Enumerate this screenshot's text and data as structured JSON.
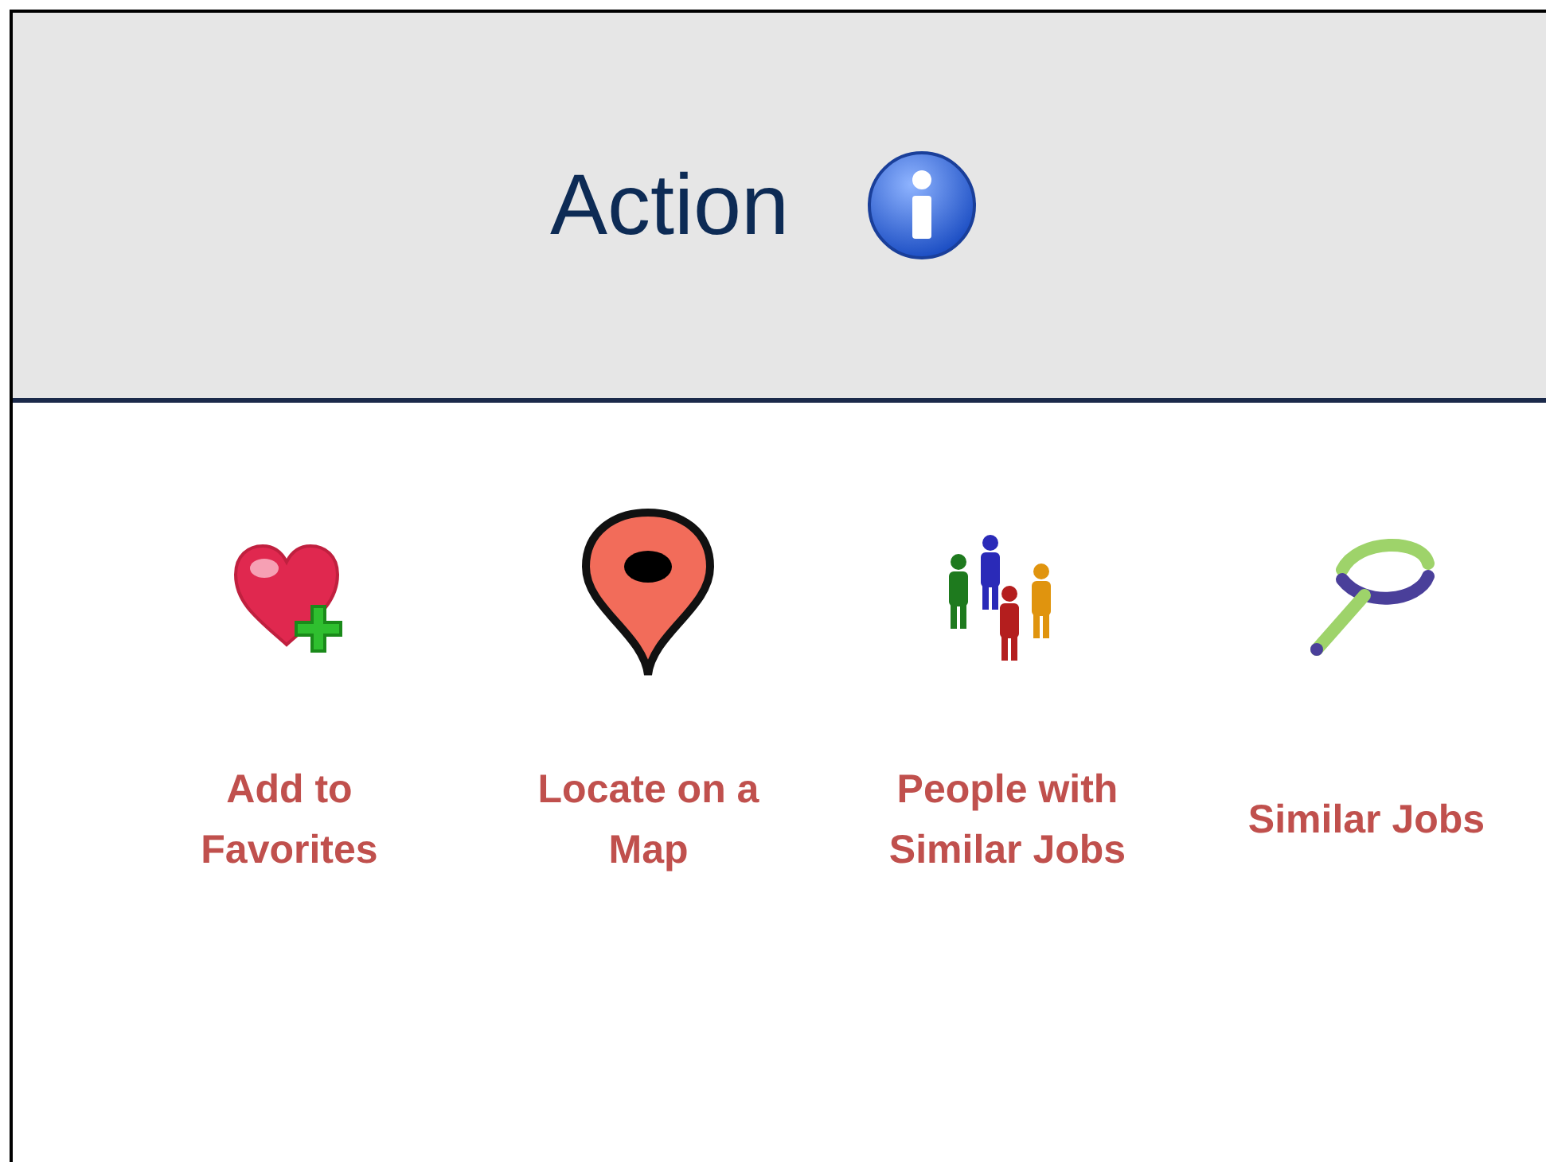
{
  "header": {
    "title": "Action"
  },
  "actions": [
    {
      "label": "Add to Favorites",
      "kind": "favorite"
    },
    {
      "label": "Locate on a Map",
      "kind": "map"
    },
    {
      "label": "People with Similar Jobs",
      "kind": "people"
    },
    {
      "label": "Similar Jobs",
      "kind": "search"
    }
  ]
}
